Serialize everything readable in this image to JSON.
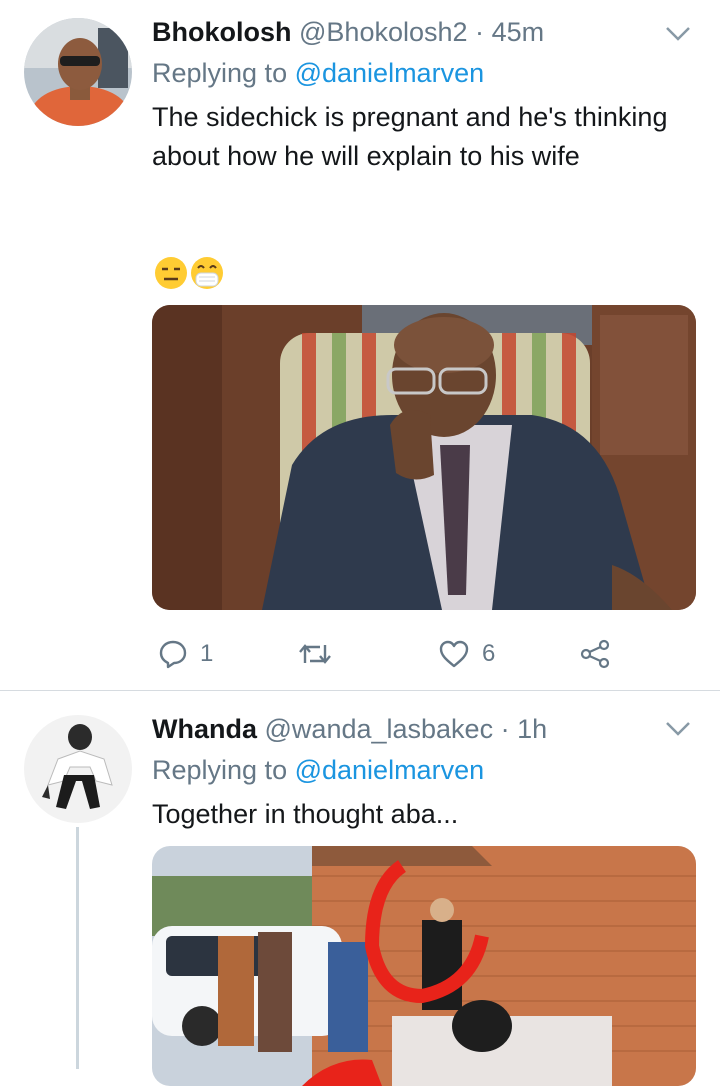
{
  "tweets": [
    {
      "name": "Bhokolosh",
      "handle": "@Bhokolosh2",
      "separator": "·",
      "time": "45m",
      "replying_prefix": "Replying to ",
      "replying_to": "@danielmarven",
      "text": "The sidechick is pregnant and he's thinking about how he will explain to his wife",
      "emoji_icons": [
        "expressionless-face-icon",
        "face-with-medical-mask-icon"
      ],
      "reply_count": "1",
      "retweet_count": "",
      "like_count": "6"
    },
    {
      "name": "Whanda",
      "handle": "@wanda_lasbakec",
      "separator": "·",
      "time": "1h",
      "replying_prefix": "Replying to ",
      "replying_to": "@danielmarven",
      "text": "Together in thought aba..."
    }
  ],
  "colors": {
    "text": "#14171a",
    "muted": "#657786",
    "link": "#1b95e0",
    "divider": "#d6dbe0"
  }
}
